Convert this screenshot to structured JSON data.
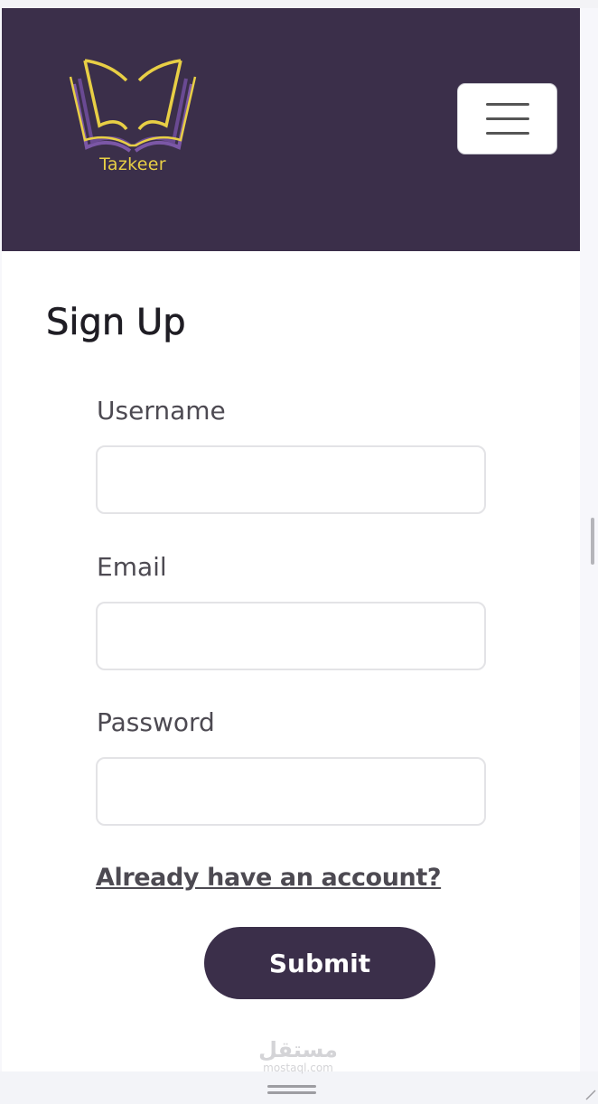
{
  "header": {
    "logo_text": "Tazkeer",
    "logo_icon": "open-book-icon",
    "menu_icon": "hamburger-menu-icon"
  },
  "form": {
    "title": "Sign Up",
    "fields": [
      {
        "label": "Username",
        "value": "",
        "placeholder": ""
      },
      {
        "label": "Email",
        "value": "",
        "placeholder": ""
      },
      {
        "label": "Password",
        "value": "",
        "placeholder": ""
      }
    ],
    "login_link": "Already have an account?",
    "submit_label": "Submit"
  },
  "watermark": {
    "arabic": "مستقل",
    "latin": "mostaql.com"
  },
  "colors": {
    "header_bg": "#3b2f4a",
    "logo_gold": "#e8cf45",
    "logo_purple": "#7b57a6",
    "button_bg": "#3b2f4a",
    "text_dark": "#1f1d24",
    "label_text": "#4d4a52"
  }
}
